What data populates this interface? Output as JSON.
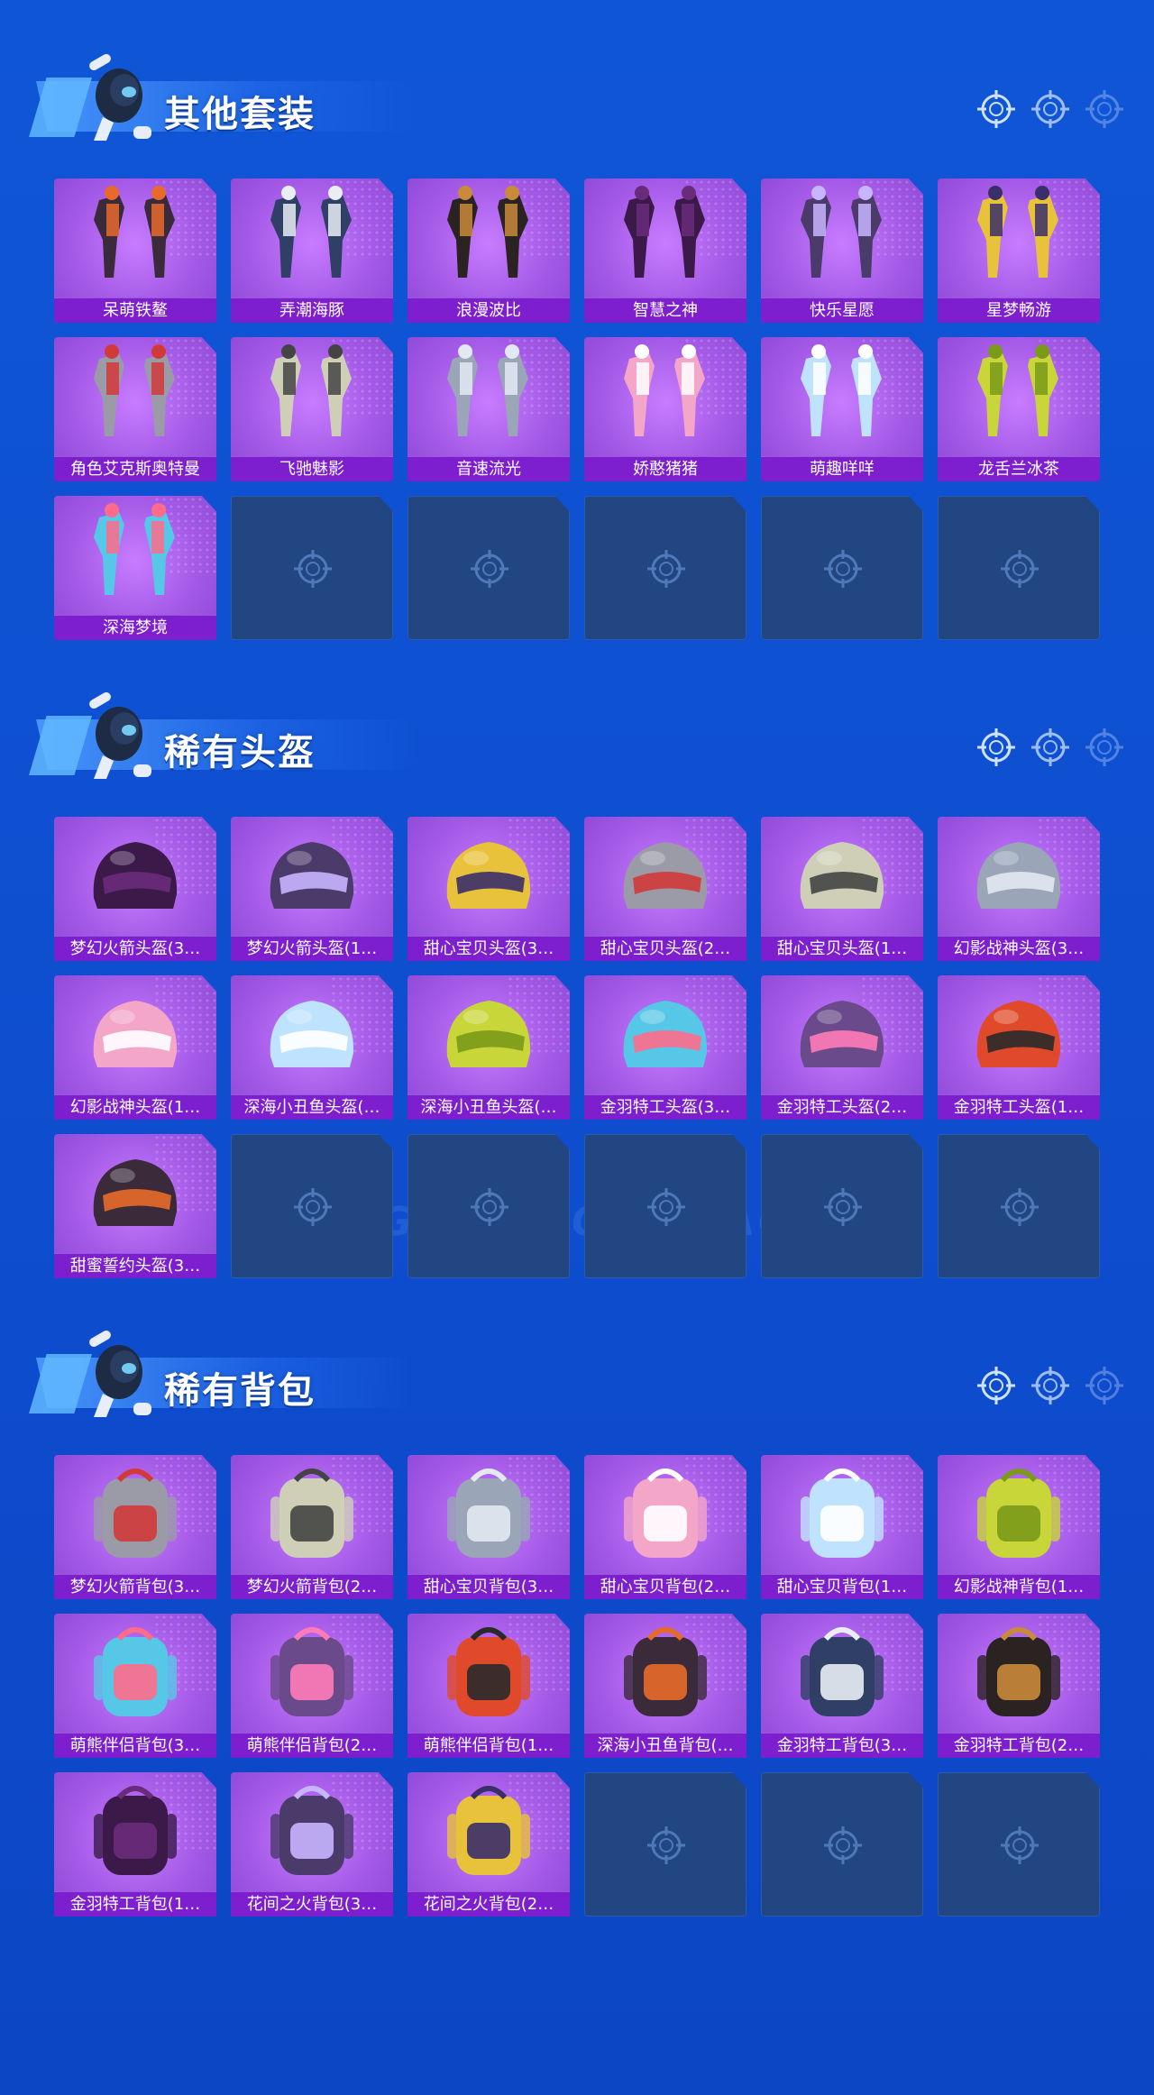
{
  "colors": {
    "background": "#0f56d6",
    "card_purple": "#a45ae6",
    "label_purple": "#7d1fcf",
    "empty_slot": "#214681",
    "header_bar": "#4d9cff"
  },
  "sections": [
    {
      "title": "其他套装",
      "items": [
        {
          "label": "呆萌铁鳌",
          "icon": "outfit-icon"
        },
        {
          "label": "弄潮海豚",
          "icon": "outfit-icon"
        },
        {
          "label": "浪漫波比",
          "icon": "outfit-icon"
        },
        {
          "label": "智慧之神",
          "icon": "outfit-icon"
        },
        {
          "label": "快乐星愿",
          "icon": "outfit-icon"
        },
        {
          "label": "星梦畅游",
          "icon": "outfit-icon"
        },
        {
          "label": "角色艾克斯奥特曼",
          "icon": "outfit-icon"
        },
        {
          "label": "飞驰魅影",
          "icon": "outfit-icon"
        },
        {
          "label": "音速流光",
          "icon": "outfit-icon"
        },
        {
          "label": "娇憨猪猪",
          "icon": "outfit-icon"
        },
        {
          "label": "萌趣咩咩",
          "icon": "outfit-icon"
        },
        {
          "label": "龙舌兰冰茶",
          "icon": "outfit-icon"
        },
        {
          "label": "深海梦境",
          "icon": "outfit-icon"
        }
      ],
      "empty_slots": 5
    },
    {
      "title": "稀有头盔",
      "items": [
        {
          "label": "梦幻火箭头盔(3…",
          "icon": "helmet-icon"
        },
        {
          "label": "梦幻火箭头盔(1…",
          "icon": "helmet-icon"
        },
        {
          "label": "甜心宝贝头盔(3…",
          "icon": "helmet-icon"
        },
        {
          "label": "甜心宝贝头盔(2…",
          "icon": "helmet-icon"
        },
        {
          "label": "甜心宝贝头盔(1…",
          "icon": "helmet-icon"
        },
        {
          "label": "幻影战神头盔(3…",
          "icon": "helmet-icon"
        },
        {
          "label": "幻影战神头盔(1…",
          "icon": "helmet-icon"
        },
        {
          "label": "深海小丑鱼头盔(…",
          "icon": "helmet-icon"
        },
        {
          "label": "深海小丑鱼头盔(…",
          "icon": "helmet-icon"
        },
        {
          "label": "金羽特工头盔(3…",
          "icon": "helmet-icon"
        },
        {
          "label": "金羽特工头盔(2…",
          "icon": "helmet-icon"
        },
        {
          "label": "金羽特工头盔(1…",
          "icon": "helmet-icon"
        },
        {
          "label": "甜蜜誓约头盔(3…",
          "icon": "helmet-icon"
        }
      ],
      "empty_slots": 5
    },
    {
      "title": "稀有背包",
      "items": [
        {
          "label": "梦幻火箭背包(3…",
          "icon": "backpack-icon"
        },
        {
          "label": "梦幻火箭背包(2…",
          "icon": "backpack-icon"
        },
        {
          "label": "甜心宝贝背包(3…",
          "icon": "backpack-icon"
        },
        {
          "label": "甜心宝贝背包(2…",
          "icon": "backpack-icon"
        },
        {
          "label": "甜心宝贝背包(1…",
          "icon": "backpack-icon"
        },
        {
          "label": "幻影战神背包(1…",
          "icon": "backpack-icon"
        },
        {
          "label": "萌熊伴侣背包(3…",
          "icon": "backpack-icon"
        },
        {
          "label": "萌熊伴侣背包(2…",
          "icon": "backpack-icon"
        },
        {
          "label": "萌熊伴侣背包(1…",
          "icon": "backpack-icon"
        },
        {
          "label": "深海小丑鱼背包(…",
          "icon": "backpack-icon"
        },
        {
          "label": "金羽特工背包(3…",
          "icon": "backpack-icon"
        },
        {
          "label": "金羽特工背包(2…",
          "icon": "backpack-icon"
        },
        {
          "label": "金羽特工背包(1…",
          "icon": "backpack-icon"
        },
        {
          "label": "花间之火背包(3…",
          "icon": "backpack-icon"
        },
        {
          "label": "花间之火背包(2…",
          "icon": "backpack-icon"
        }
      ],
      "empty_slots": 3
    }
  ],
  "watermark": "GAME FOR PEACE"
}
